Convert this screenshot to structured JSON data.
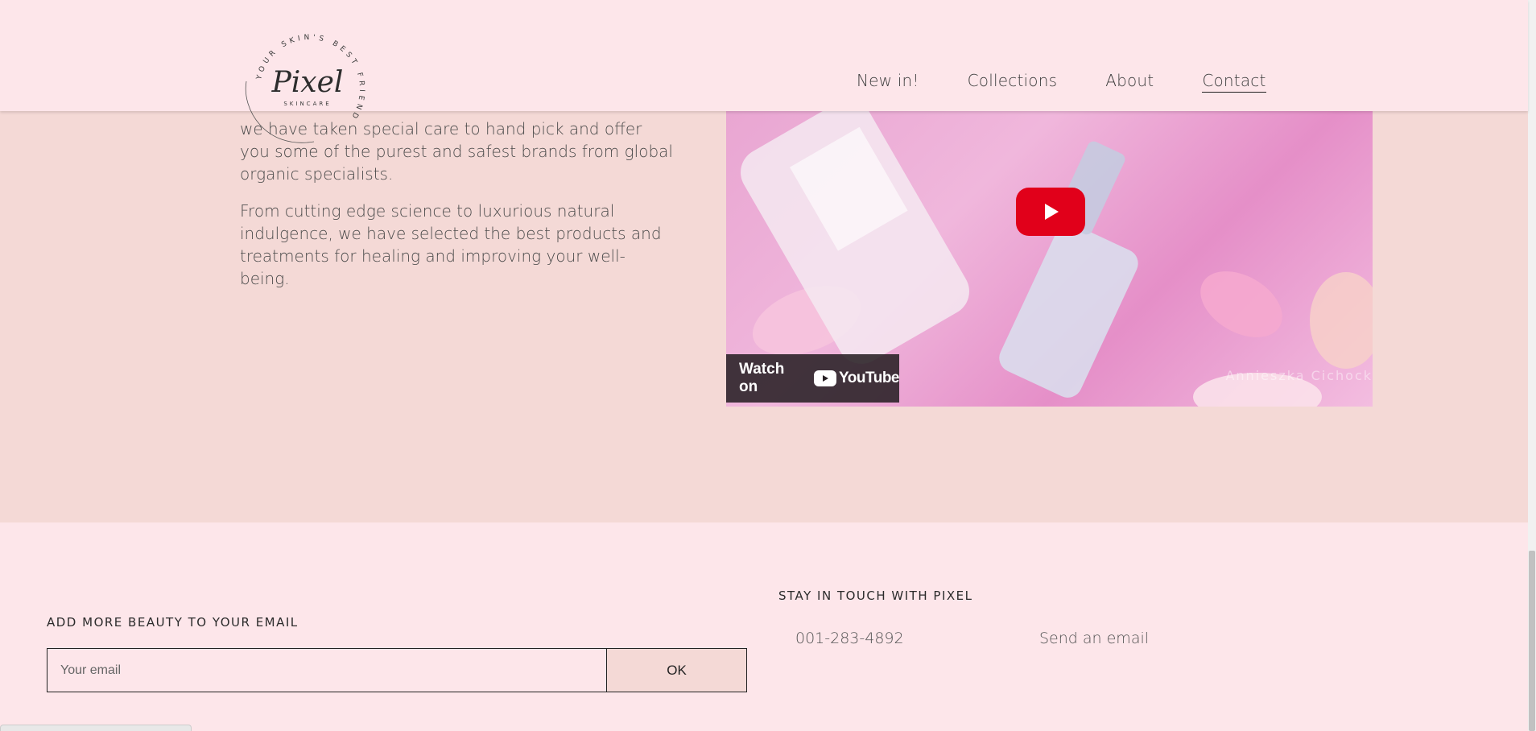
{
  "nav": {
    "items": [
      {
        "label": "New in!",
        "active": false
      },
      {
        "label": "Collections",
        "active": false
      },
      {
        "label": "About",
        "active": false
      },
      {
        "label": "Contact",
        "active": true
      }
    ]
  },
  "logo": {
    "name": "Pixel",
    "sub": "SKINCARE",
    "ring_text": "YOUR SKIN'S BEST FRIEND"
  },
  "content": {
    "paragraph1": "we have taken special care to hand pick and offer you some of the purest and safest brands from global organic specialists.",
    "paragraph2": "From cutting edge science to luxurious natural indulgence, we have selected the best products and treatments for healing and improving your well-being."
  },
  "video": {
    "watch_label": "Watch on",
    "youtube_label": "YouTube",
    "watermark": "Annieszka Cichock"
  },
  "footer": {
    "newsletter_title": "ADD MORE BEAUTY TO YOUR EMAIL",
    "email_placeholder": "Your email",
    "ok_label": "OK",
    "contact_title": "STAY IN TOUCH WITH PIXEL",
    "phone": "001-283-4892",
    "email_link": "Send an email"
  },
  "colors": {
    "header_bg": "#fde6ea",
    "section_bg": "#f4d9d6",
    "play_red": "#e1001a"
  }
}
